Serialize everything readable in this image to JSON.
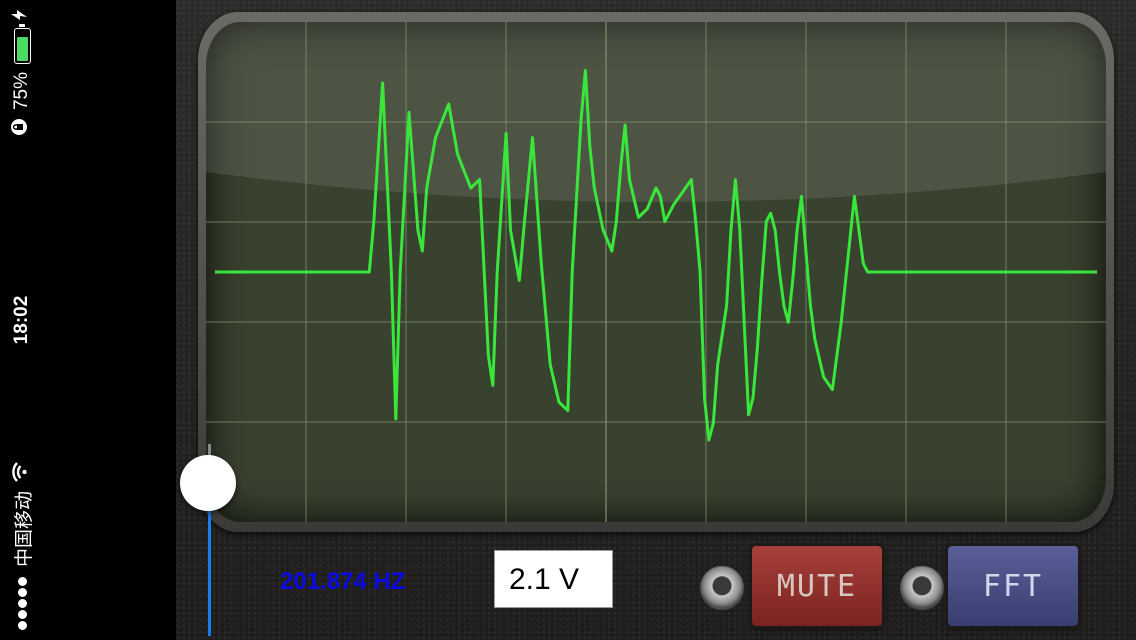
{
  "status_bar": {
    "carrier": "中国移动",
    "time": "18:02",
    "battery_percent": "75%",
    "signal_bars": 5,
    "battery_level": 0.75,
    "icons": [
      "signal-dots-icon",
      "wifi-icon",
      "orientation-lock-icon",
      "battery-icon",
      "charging-bolt-icon"
    ]
  },
  "scope": {
    "waveform_color": "#39e63a",
    "screen_color": "#39412f",
    "grid_color": "#8b9873",
    "waveform": [
      [
        0,
        0.5
      ],
      [
        0.175,
        0.5
      ],
      [
        0.18,
        0.62
      ],
      [
        0.19,
        0.95
      ],
      [
        0.2,
        0.5
      ],
      [
        0.205,
        0.15
      ],
      [
        0.21,
        0.5
      ],
      [
        0.22,
        0.88
      ],
      [
        0.23,
        0.6
      ],
      [
        0.235,
        0.55
      ],
      [
        0.24,
        0.7
      ],
      [
        0.25,
        0.82
      ],
      [
        0.265,
        0.9
      ],
      [
        0.275,
        0.78
      ],
      [
        0.29,
        0.7
      ],
      [
        0.3,
        0.72
      ],
      [
        0.31,
        0.3
      ],
      [
        0.315,
        0.23
      ],
      [
        0.32,
        0.5
      ],
      [
        0.33,
        0.83
      ],
      [
        0.335,
        0.6
      ],
      [
        0.345,
        0.48
      ],
      [
        0.35,
        0.6
      ],
      [
        0.36,
        0.82
      ],
      [
        0.37,
        0.52
      ],
      [
        0.38,
        0.28
      ],
      [
        0.39,
        0.19
      ],
      [
        0.4,
        0.17
      ],
      [
        0.405,
        0.5
      ],
      [
        0.41,
        0.68
      ],
      [
        0.415,
        0.86
      ],
      [
        0.42,
        0.98
      ],
      [
        0.425,
        0.8
      ],
      [
        0.43,
        0.7
      ],
      [
        0.44,
        0.6
      ],
      [
        0.45,
        0.55
      ],
      [
        0.455,
        0.62
      ],
      [
        0.46,
        0.75
      ],
      [
        0.465,
        0.85
      ],
      [
        0.47,
        0.72
      ],
      [
        0.48,
        0.63
      ],
      [
        0.49,
        0.65
      ],
      [
        0.5,
        0.7
      ],
      [
        0.505,
        0.68
      ],
      [
        0.51,
        0.62
      ],
      [
        0.52,
        0.66
      ],
      [
        0.53,
        0.69
      ],
      [
        0.54,
        0.72
      ],
      [
        0.545,
        0.62
      ],
      [
        0.55,
        0.5
      ],
      [
        0.555,
        0.2
      ],
      [
        0.56,
        0.1
      ],
      [
        0.565,
        0.14
      ],
      [
        0.57,
        0.28
      ],
      [
        0.58,
        0.42
      ],
      [
        0.585,
        0.6
      ],
      [
        0.59,
        0.72
      ],
      [
        0.595,
        0.6
      ],
      [
        0.6,
        0.38
      ],
      [
        0.605,
        0.16
      ],
      [
        0.61,
        0.2
      ],
      [
        0.615,
        0.32
      ],
      [
        0.62,
        0.48
      ],
      [
        0.625,
        0.62
      ],
      [
        0.63,
        0.64
      ],
      [
        0.635,
        0.6
      ],
      [
        0.64,
        0.5
      ],
      [
        0.645,
        0.42
      ],
      [
        0.65,
        0.38
      ],
      [
        0.655,
        0.48
      ],
      [
        0.66,
        0.6
      ],
      [
        0.665,
        0.68
      ],
      [
        0.67,
        0.55
      ],
      [
        0.675,
        0.42
      ],
      [
        0.68,
        0.34
      ],
      [
        0.69,
        0.25
      ],
      [
        0.7,
        0.22
      ],
      [
        0.71,
        0.38
      ],
      [
        0.72,
        0.58
      ],
      [
        0.725,
        0.68
      ],
      [
        0.73,
        0.6
      ],
      [
        0.735,
        0.52
      ],
      [
        0.74,
        0.5
      ],
      [
        0.75,
        0.5
      ],
      [
        1,
        0.5
      ]
    ]
  },
  "controls": {
    "frequency": "201.874 HZ",
    "voltage": "2.1 V",
    "mute_label": "MUTE",
    "fft_label": "FFT",
    "slider_value": 0.22
  }
}
